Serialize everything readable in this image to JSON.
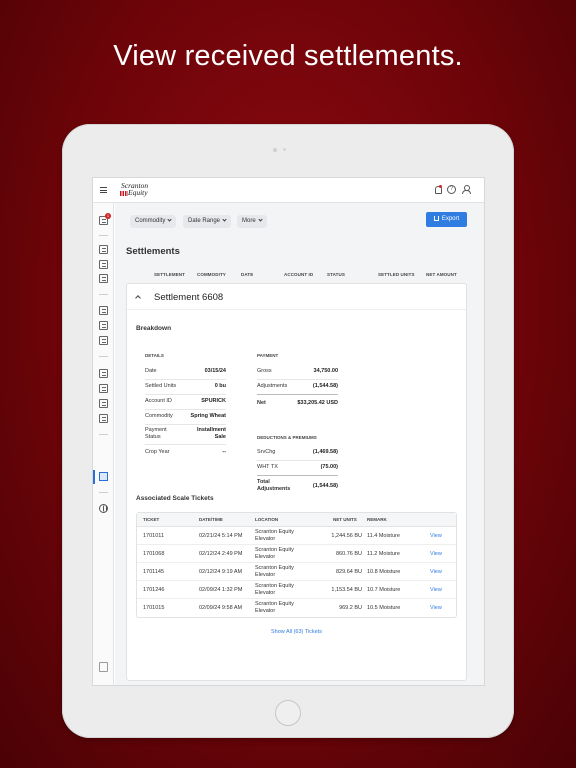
{
  "headline": "View received settlements.",
  "app": {
    "logo_line1": "Scranton",
    "logo_line2": "Equity",
    "help_glyph": "?",
    "sidebar_badge": "1",
    "icons": [
      "menu-icon",
      "bell-icon",
      "help-icon",
      "user-icon",
      "globe-icon",
      "trash-icon"
    ],
    "accent": "#2f7de1",
    "brand_red": "#d0232a"
  },
  "filters": {
    "commodity": "Commodity",
    "date_range": "Date Range",
    "more": "More",
    "export": "Export"
  },
  "page": {
    "title": "Settlements",
    "columns": [
      "SETTLEMENT",
      "COMMODITY",
      "DATE",
      "ACCOUNT ID",
      "STATUS",
      "SETTLED UNITS",
      "NET AMOUNT"
    ]
  },
  "settlement": {
    "title": "Settlement 6608",
    "breakdown_title": "Breakdown",
    "details": {
      "heading": "DETAILS",
      "date_label": "Date",
      "date_value": "03/15/24",
      "units_label": "Settled Units",
      "units_value": "0 bu",
      "account_label": "Account ID",
      "account_value": "SPURICK",
      "commodity_label": "Commodity",
      "commodity_value": "Spring Wheat",
      "status_label_1": "Payment",
      "status_label_2": "Status",
      "status_value_1": "Installment",
      "status_value_2": "Sale",
      "crop_label": "Crop Year",
      "crop_value": "--"
    },
    "payment": {
      "heading": "PAYMENT",
      "gross_label": "Gross",
      "gross_value": "34,750.00",
      "adj_label": "Adjustments",
      "adj_value": "(1,544.58)",
      "net_label": "Net",
      "net_value": "$33,205.42 USD"
    },
    "deductions": {
      "heading": "DEDUCTIONS & PREMIUMS",
      "srv_label": "SrvChg",
      "srv_value": "(1,469.58)",
      "wht_label": "WHT TX",
      "wht_value": "(75.00)",
      "total_label_1": "Total",
      "total_label_2": "Adjustments",
      "total_value": "(1,544.58)"
    },
    "tickets": {
      "title": "Associated Scale Tickets",
      "headers": [
        "TICKET",
        "DATE/TIME",
        "LOCATION",
        "NET UNITS",
        "REMARK"
      ],
      "rows": [
        {
          "ticket": "1701011",
          "datetime": "02/21/24 5:14 PM",
          "loc1": "Scranton Equity",
          "loc2": "Elevator",
          "net": "1,244.56 BU",
          "remark": "11.4 Moisture",
          "action": "View"
        },
        {
          "ticket": "1701068",
          "datetime": "02/12/24 2:49 PM",
          "loc1": "Scranton Equity",
          "loc2": "Elevator",
          "net": "860.76 BU",
          "remark": "11.2 Moisture",
          "action": "View"
        },
        {
          "ticket": "1701145",
          "datetime": "02/12/24 9:19 AM",
          "loc1": "Scranton Equity",
          "loc2": "Elevator",
          "net": "829.64 BU",
          "remark": "10.8 Moisture",
          "action": "View"
        },
        {
          "ticket": "1701246",
          "datetime": "02/09/24 1:32 PM",
          "loc1": "Scranton Equity",
          "loc2": "Elevator",
          "net": "1,153.54 BU",
          "remark": "10.7 Moisture",
          "action": "View"
        },
        {
          "ticket": "1701015",
          "datetime": "02/09/24 9:58 AM",
          "loc1": "Scranton Equity",
          "loc2": "Elevator",
          "net": "969.2 BU",
          "remark": "10.5 Moisture",
          "action": "View"
        }
      ],
      "show_all": "Show All (63) Tickets"
    }
  }
}
